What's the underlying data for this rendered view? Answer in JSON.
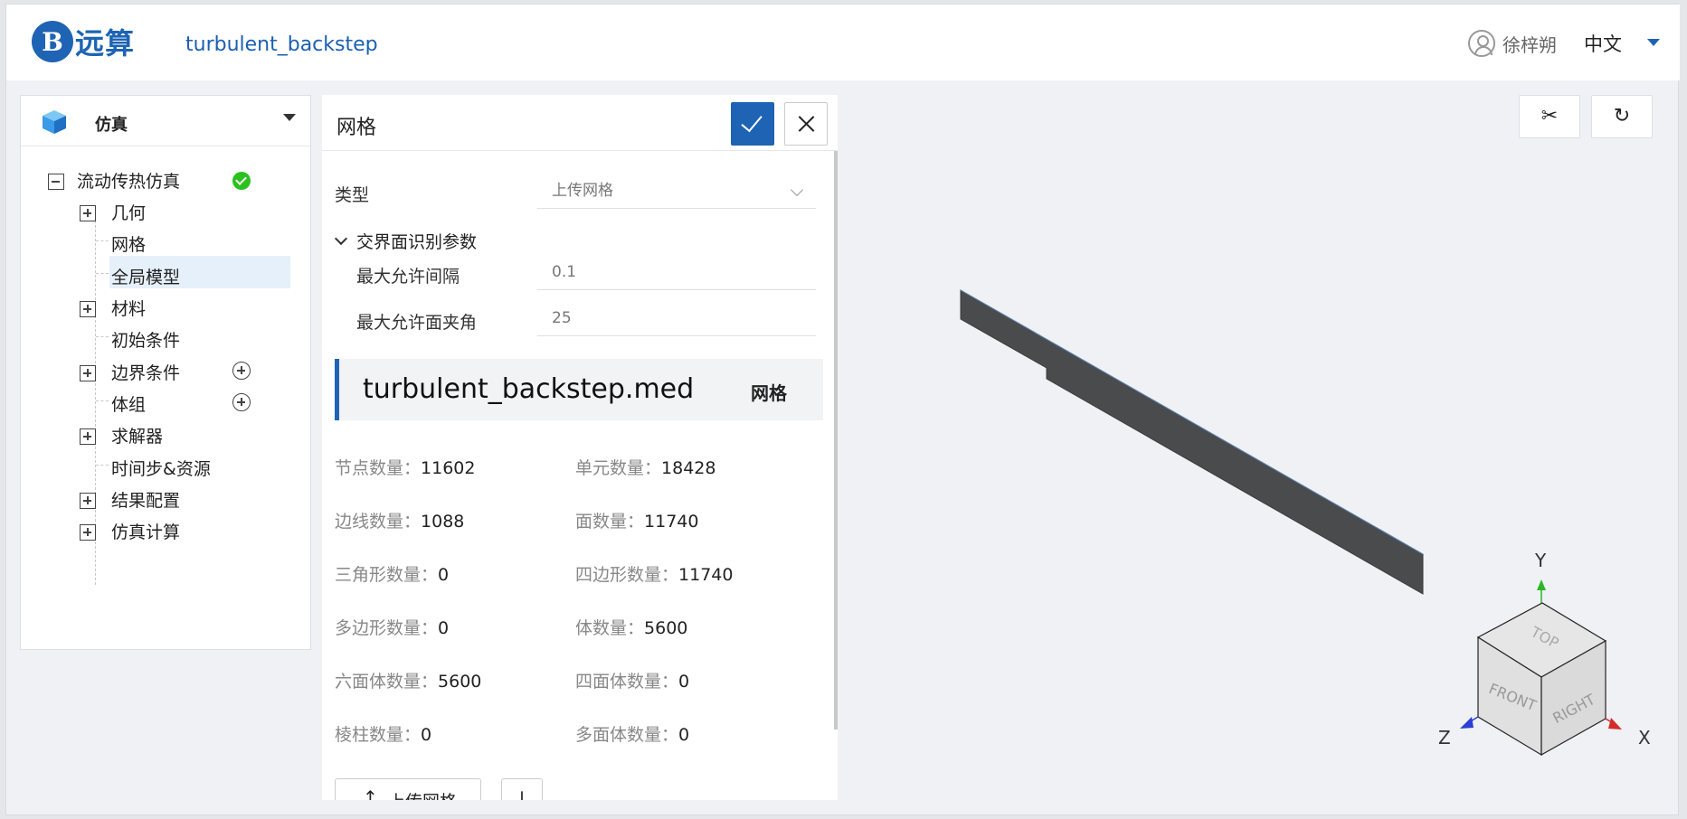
{
  "app": {
    "logo_char": "B",
    "logo_text": "远算",
    "project_title": "turbulent_backstep",
    "user_name": "徐梓朔",
    "language": "中文"
  },
  "sidebar": {
    "title": "仿真",
    "root": {
      "label": "流动传热仿真",
      "status": "ok"
    },
    "items": [
      {
        "label": "几何",
        "expandable": true
      },
      {
        "label": "网格",
        "expandable": false,
        "selected": true
      },
      {
        "label": "全局模型",
        "expandable": false
      },
      {
        "label": "材料",
        "expandable": true
      },
      {
        "label": "初始条件",
        "expandable": false
      },
      {
        "label": "边界条件",
        "expandable": true,
        "addable": true
      },
      {
        "label": "体组",
        "expandable": false,
        "addable": true
      },
      {
        "label": "求解器",
        "expandable": true
      },
      {
        "label": "时间步&资源",
        "expandable": false
      },
      {
        "label": "结果配置",
        "expandable": true
      },
      {
        "label": "仿真计算",
        "expandable": true
      }
    ]
  },
  "mesh_panel": {
    "title": "网格",
    "type_label": "类型",
    "type_value": "上传网格",
    "section_label": "交界面识别参数",
    "max_gap_label": "最大允许间隔",
    "max_gap_value": "0.1",
    "max_angle_label": "最大允许面夹角",
    "max_angle_value": "25",
    "file_name": "turbulent_backstep.med",
    "file_tag": "网格",
    "stats": [
      {
        "key": "节点数量：",
        "value": "11602"
      },
      {
        "key": "单元数量：",
        "value": "18428"
      },
      {
        "key": "边线数量：",
        "value": "1088"
      },
      {
        "key": "面数量：",
        "value": "11740"
      },
      {
        "key": "三角形数量：",
        "value": "0"
      },
      {
        "key": "四边形数量：",
        "value": "11740"
      },
      {
        "key": "多边形数量：",
        "value": "0"
      },
      {
        "key": "体数量：",
        "value": "5600"
      },
      {
        "key": "六面体数量：",
        "value": "5600"
      },
      {
        "key": "四面体数量：",
        "value": "0"
      },
      {
        "key": "棱柱数量：",
        "value": "0"
      },
      {
        "key": "多面体数量：",
        "value": "0"
      }
    ],
    "upload_label": "上传网格"
  },
  "viewport": {
    "toolbar": {
      "cut_icon": "scissors-icon",
      "reset_icon": "rotate-icon"
    },
    "axes": {
      "x": "X",
      "y": "Y",
      "z": "Z"
    },
    "cube_faces": {
      "top": "TOP",
      "front": "FRONT",
      "right": "RIGHT"
    },
    "colors": {
      "mesh": "#4a4b4c",
      "x_axis": "#d62a2a",
      "y_axis": "#2bb52b",
      "z_axis": "#2a3fd6"
    }
  }
}
